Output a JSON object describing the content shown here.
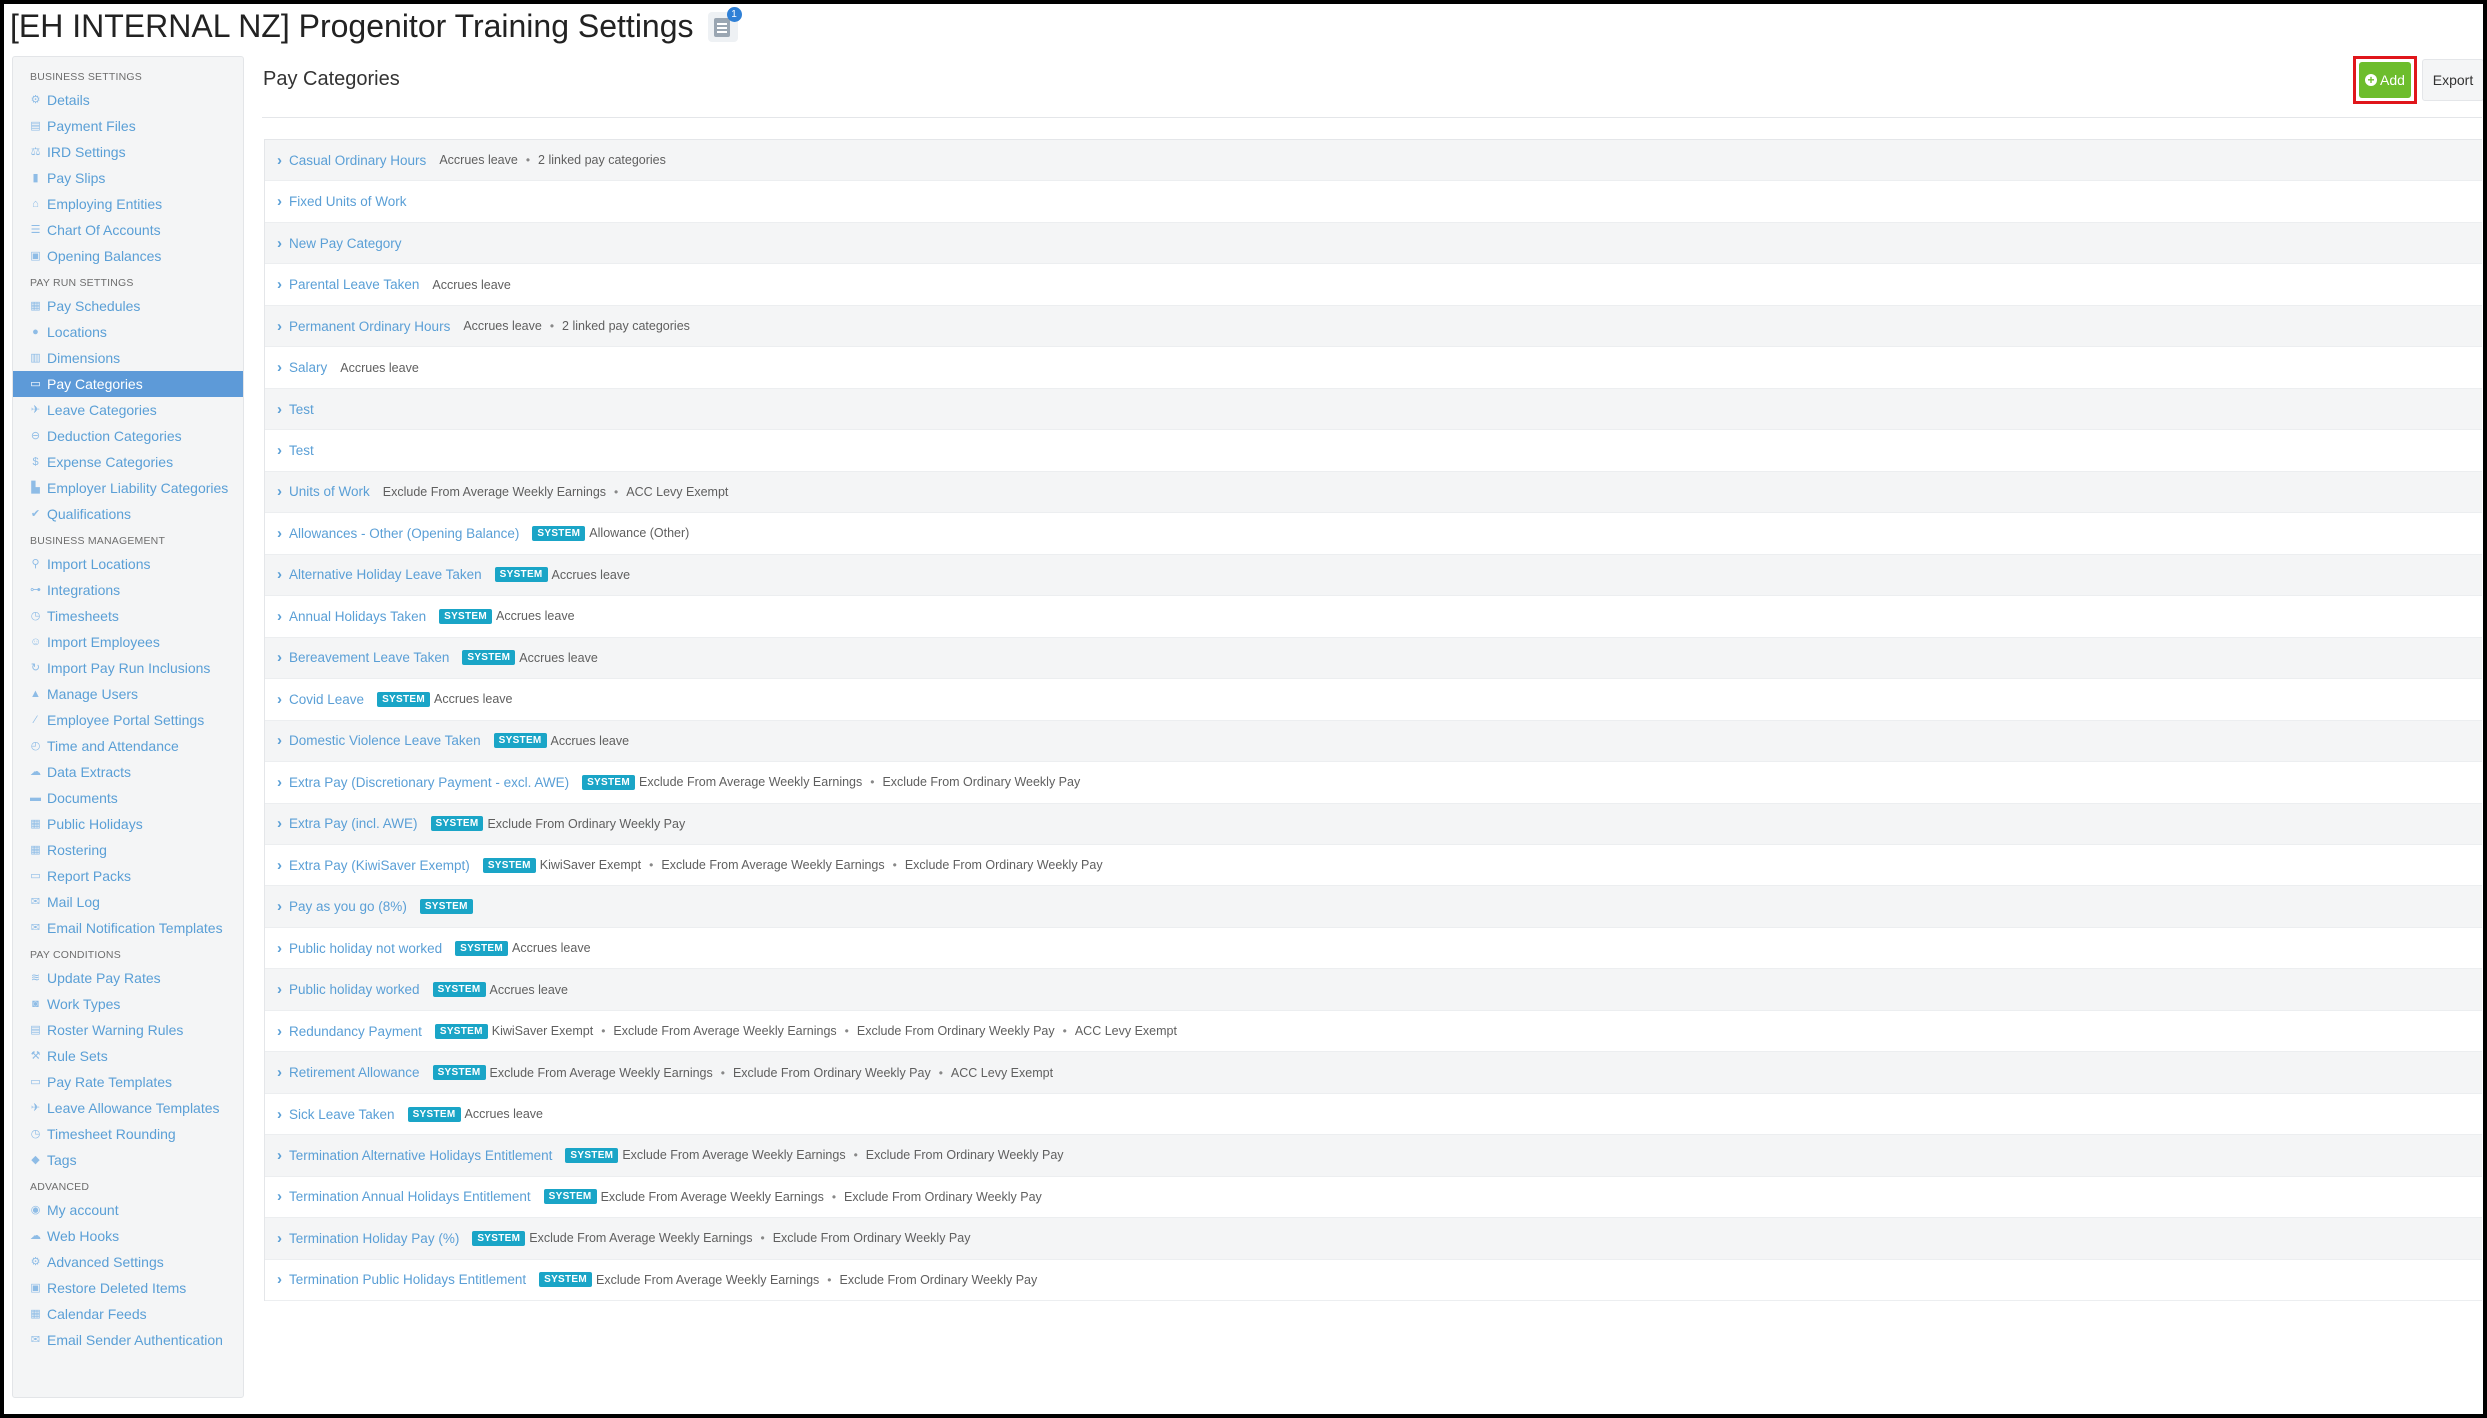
{
  "page": {
    "title": "[EH INTERNAL NZ] Progenitor Training Settings",
    "notification_count": "1"
  },
  "sidebar": {
    "sections": [
      {
        "heading": "BUSINESS SETTINGS",
        "items": [
          {
            "label": "Details",
            "icon": "gear-icon",
            "glyph": "⚙"
          },
          {
            "label": "Payment Files",
            "icon": "file-icon",
            "glyph": "▤"
          },
          {
            "label": "IRD Settings",
            "icon": "scales-icon",
            "glyph": "⚖"
          },
          {
            "label": "Pay Slips",
            "icon": "document-icon",
            "glyph": "▮"
          },
          {
            "label": "Employing Entities",
            "icon": "bank-icon",
            "glyph": "⌂"
          },
          {
            "label": "Chart Of Accounts",
            "icon": "list-icon",
            "glyph": "☰"
          },
          {
            "label": "Opening Balances",
            "icon": "ledger-icon",
            "glyph": "▣"
          }
        ]
      },
      {
        "heading": "PAY RUN SETTINGS",
        "items": [
          {
            "label": "Pay Schedules",
            "icon": "calendar-icon",
            "glyph": "▦"
          },
          {
            "label": "Locations",
            "icon": "globe-icon",
            "glyph": "●"
          },
          {
            "label": "Dimensions",
            "icon": "chart-icon",
            "glyph": "▥"
          },
          {
            "label": "Pay Categories",
            "icon": "money-icon",
            "glyph": "▭",
            "active": true
          },
          {
            "label": "Leave Categories",
            "icon": "plane-icon",
            "glyph": "✈"
          },
          {
            "label": "Deduction Categories",
            "icon": "minus-circle-icon",
            "glyph": "⊖"
          },
          {
            "label": "Expense Categories",
            "icon": "dollar-icon",
            "glyph": "$"
          },
          {
            "label": "Employer Liability Categories",
            "icon": "bar-chart-icon",
            "glyph": "▙"
          },
          {
            "label": "Qualifications",
            "icon": "check-icon",
            "glyph": "✔"
          }
        ]
      },
      {
        "heading": "BUSINESS MANAGEMENT",
        "items": [
          {
            "label": "Import Locations",
            "icon": "map-pin-icon",
            "glyph": "⚲"
          },
          {
            "label": "Integrations",
            "icon": "sitemap-icon",
            "glyph": "⊶"
          },
          {
            "label": "Timesheets",
            "icon": "clock-icon",
            "glyph": "◷"
          },
          {
            "label": "Import Employees",
            "icon": "people-icon",
            "glyph": "☺"
          },
          {
            "label": "Import Pay Run Inclusions",
            "icon": "refresh-icon",
            "glyph": "↻"
          },
          {
            "label": "Manage Users",
            "icon": "lock-icon",
            "glyph": "▲"
          },
          {
            "label": "Employee Portal Settings",
            "icon": "magic-wand-icon",
            "glyph": "⁄"
          },
          {
            "label": "Time and Attendance",
            "icon": "stopwatch-icon",
            "glyph": "◴"
          },
          {
            "label": "Data Extracts",
            "icon": "cloud-download-icon",
            "glyph": "☁"
          },
          {
            "label": "Documents",
            "icon": "folder-icon",
            "glyph": "▬"
          },
          {
            "label": "Public Holidays",
            "icon": "calendar-icon",
            "glyph": "▦"
          },
          {
            "label": "Rostering",
            "icon": "calendar-grid-icon",
            "glyph": "▦"
          },
          {
            "label": "Report Packs",
            "icon": "folder-open-icon",
            "glyph": "▭"
          },
          {
            "label": "Mail Log",
            "icon": "envelope-icon",
            "glyph": "✉"
          },
          {
            "label": "Email Notification Templates",
            "icon": "envelope-icon",
            "glyph": "✉"
          }
        ]
      },
      {
        "heading": "PAY CONDITIONS",
        "items": [
          {
            "label": "Update Pay Rates",
            "icon": "hand-money-icon",
            "glyph": "≋"
          },
          {
            "label": "Work Types",
            "icon": "camera-icon",
            "glyph": "◙"
          },
          {
            "label": "Roster Warning Rules",
            "icon": "roster-icon",
            "glyph": "▤"
          },
          {
            "label": "Rule Sets",
            "icon": "gavel-icon",
            "glyph": "⚒"
          },
          {
            "label": "Pay Rate Templates",
            "icon": "money-icon",
            "glyph": "▭"
          },
          {
            "label": "Leave Allowance Templates",
            "icon": "plane-icon",
            "glyph": "✈"
          },
          {
            "label": "Timesheet Rounding",
            "icon": "clock-icon",
            "glyph": "◷"
          },
          {
            "label": "Tags",
            "icon": "tag-icon",
            "glyph": "◆"
          }
        ]
      },
      {
        "heading": "ADVANCED",
        "items": [
          {
            "label": "My account",
            "icon": "user-circle-icon",
            "glyph": "◉"
          },
          {
            "label": "Web Hooks",
            "icon": "cloud-icon",
            "glyph": "☁"
          },
          {
            "label": "Advanced Settings",
            "icon": "gear-icon",
            "glyph": "⚙"
          },
          {
            "label": "Restore Deleted Items",
            "icon": "restore-icon",
            "glyph": "▣"
          },
          {
            "label": "Calendar Feeds",
            "icon": "calendar-icon",
            "glyph": "▦"
          },
          {
            "label": "Email Sender Authentication",
            "icon": "envelope-icon",
            "glyph": "✉"
          }
        ]
      }
    ]
  },
  "main": {
    "title": "Pay Categories",
    "add_label": "Add",
    "export_label": "Export",
    "system_badge": "SYSTEM",
    "categories": [
      {
        "name": "Casual Ordinary Hours",
        "system": false,
        "attributes": [
          "Accrues leave",
          "2 linked pay categories"
        ]
      },
      {
        "name": "Fixed Units of Work",
        "system": false,
        "attributes": []
      },
      {
        "name": "New Pay Category",
        "system": false,
        "attributes": []
      },
      {
        "name": "Parental Leave Taken",
        "system": false,
        "attributes": [
          "Accrues leave"
        ]
      },
      {
        "name": "Permanent Ordinary Hours",
        "system": false,
        "attributes": [
          "Accrues leave",
          "2 linked pay categories"
        ]
      },
      {
        "name": "Salary",
        "system": false,
        "attributes": [
          "Accrues leave"
        ]
      },
      {
        "name": "Test",
        "system": false,
        "attributes": []
      },
      {
        "name": "Test",
        "system": false,
        "attributes": []
      },
      {
        "name": "Units of Work",
        "system": false,
        "attributes": [
          "Exclude From Average Weekly Earnings",
          "ACC Levy Exempt"
        ]
      },
      {
        "name": "Allowances - Other (Opening Balance)",
        "system": true,
        "attributes": [
          "Allowance (Other)"
        ]
      },
      {
        "name": "Alternative Holiday Leave Taken",
        "system": true,
        "attributes": [
          "Accrues leave"
        ]
      },
      {
        "name": "Annual Holidays Taken",
        "system": true,
        "attributes": [
          "Accrues leave"
        ]
      },
      {
        "name": "Bereavement Leave Taken",
        "system": true,
        "attributes": [
          "Accrues leave"
        ]
      },
      {
        "name": "Covid Leave",
        "system": true,
        "attributes": [
          "Accrues leave"
        ]
      },
      {
        "name": "Domestic Violence Leave Taken",
        "system": true,
        "attributes": [
          "Accrues leave"
        ]
      },
      {
        "name": "Extra Pay (Discretionary Payment - excl. AWE)",
        "system": true,
        "attributes": [
          "Exclude From Average Weekly Earnings",
          "Exclude From Ordinary Weekly Pay"
        ]
      },
      {
        "name": "Extra Pay (incl. AWE)",
        "system": true,
        "attributes": [
          "Exclude From Ordinary Weekly Pay"
        ]
      },
      {
        "name": "Extra Pay (KiwiSaver Exempt)",
        "system": true,
        "attributes": [
          "KiwiSaver Exempt",
          "Exclude From Average Weekly Earnings",
          "Exclude From Ordinary Weekly Pay"
        ]
      },
      {
        "name": "Pay as you go (8%)",
        "system": true,
        "attributes": []
      },
      {
        "name": "Public holiday not worked",
        "system": true,
        "attributes": [
          "Accrues leave"
        ]
      },
      {
        "name": "Public holiday worked",
        "system": true,
        "attributes": [
          "Accrues leave"
        ]
      },
      {
        "name": "Redundancy Payment",
        "system": true,
        "attributes": [
          "KiwiSaver Exempt",
          "Exclude From Average Weekly Earnings",
          "Exclude From Ordinary Weekly Pay",
          "ACC Levy Exempt"
        ]
      },
      {
        "name": "Retirement Allowance",
        "system": true,
        "attributes": [
          "Exclude From Average Weekly Earnings",
          "Exclude From Ordinary Weekly Pay",
          "ACC Levy Exempt"
        ]
      },
      {
        "name": "Sick Leave Taken",
        "system": true,
        "attributes": [
          "Accrues leave"
        ]
      },
      {
        "name": "Termination Alternative Holidays Entitlement",
        "system": true,
        "attributes": [
          "Exclude From Average Weekly Earnings",
          "Exclude From Ordinary Weekly Pay"
        ]
      },
      {
        "name": "Termination Annual Holidays Entitlement",
        "system": true,
        "attributes": [
          "Exclude From Average Weekly Earnings",
          "Exclude From Ordinary Weekly Pay"
        ]
      },
      {
        "name": "Termination Holiday Pay (%)",
        "system": true,
        "attributes": [
          "Exclude From Average Weekly Earnings",
          "Exclude From Ordinary Weekly Pay"
        ]
      },
      {
        "name": "Termination Public Holidays Entitlement",
        "system": true,
        "attributes": [
          "Exclude From Average Weekly Earnings",
          "Exclude From Ordinary Weekly Pay"
        ]
      }
    ]
  },
  "colors": {
    "link": "#5a9fd6",
    "active_nav": "#5d9ad8",
    "add_button": "#6dbd2c",
    "highlight_border": "#e0161b",
    "system_badge": "#1aa5c7"
  }
}
